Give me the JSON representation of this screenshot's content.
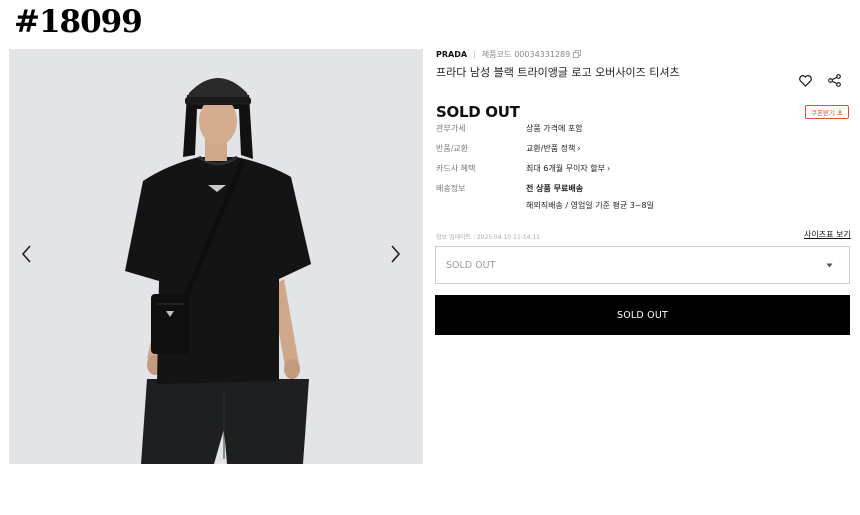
{
  "listing": {
    "number": "#18099"
  },
  "product": {
    "brand": "PRADA",
    "sku_label": "제품코드",
    "sku": "00034331289",
    "title": "프라다 남성 블랙 트라이앵글 로고 오버사이즈 티셔츠",
    "status": "SOLD OUT"
  },
  "coupon": {
    "label": "쿠폰받기"
  },
  "info": [
    {
      "key": "관부가세",
      "value": "상품 가격에 포함"
    },
    {
      "key": "반품/교환",
      "value": "교환/반품 정책"
    },
    {
      "key": "카드사 혜택",
      "value": "최대 6개월 무이자 할부"
    },
    {
      "key": "배송정보",
      "value": "전 상품 무료배송",
      "value2": "해외직배송 / 영업일 기준 평균 3~8일"
    }
  ],
  "updated": "정보 업데이트 : 2025.04.10 11:14:11",
  "size_guide": {
    "label": "사이즈표 보기"
  },
  "option": {
    "selected": "SOLD OUT"
  },
  "buy_button": {
    "label": "SOLD OUT"
  },
  "colors": {
    "accent": "#e3532b",
    "button_bg": "#000000",
    "image_bg": "#e3e4e7"
  },
  "icons": [
    "chevron-left-icon",
    "chevron-right-icon",
    "copy-icon",
    "heart-icon",
    "share-icon",
    "caret-down-icon",
    "chevron-right-small-icon"
  ]
}
